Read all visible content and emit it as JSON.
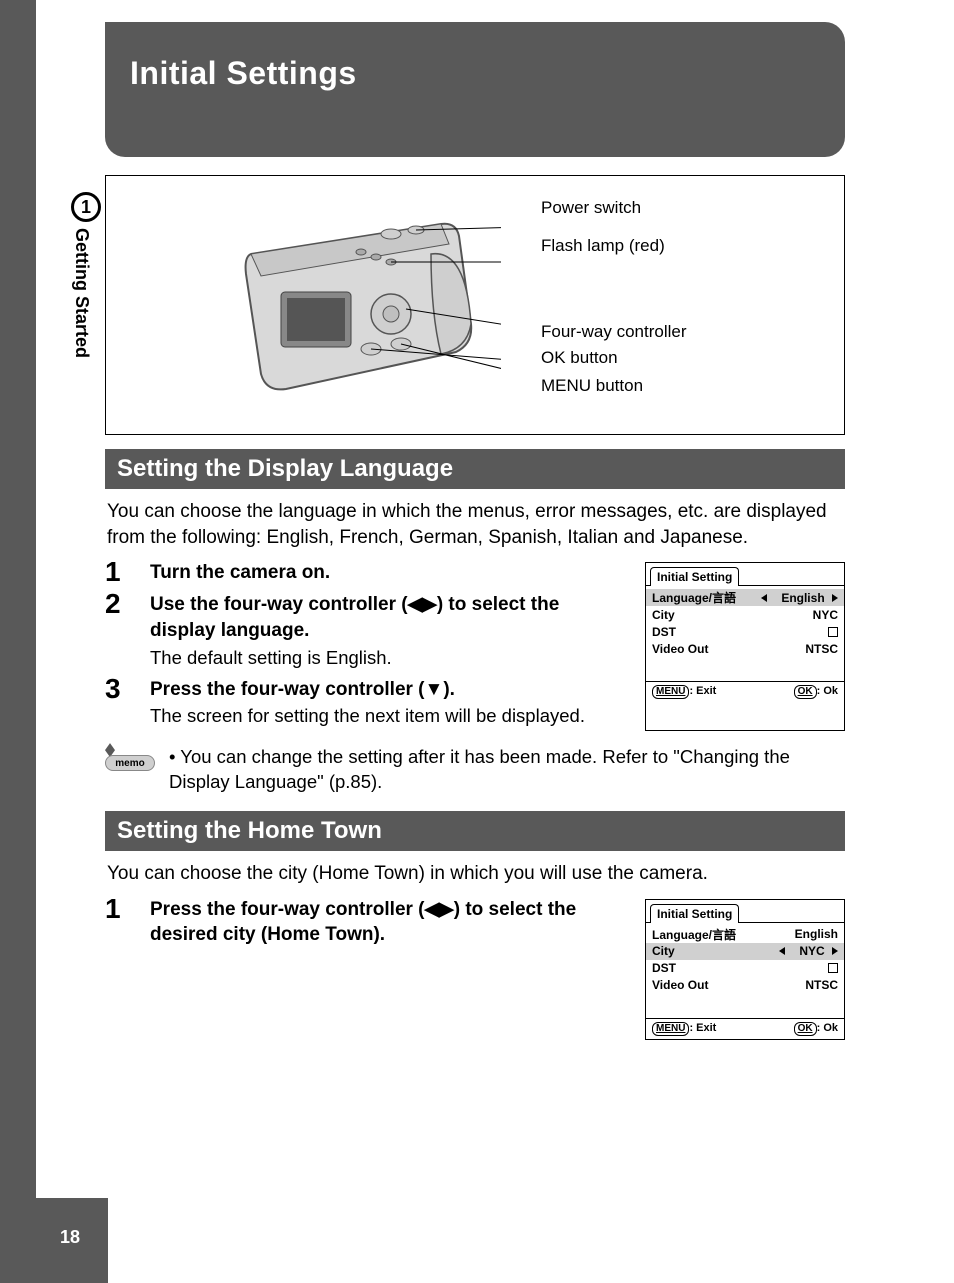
{
  "chapter": {
    "number": "1",
    "tab_label": "Getting Started"
  },
  "page_title": "Initial Settings",
  "page_number": "18",
  "diagram_callouts": {
    "c1": "Power switch",
    "c2": "Flash lamp (red)",
    "c3": "Four-way controller",
    "c4": "OK button",
    "c5": "MENU button"
  },
  "section1": {
    "heading": "Setting the Display Language",
    "intro": "You can choose the language in which the menus, error messages, etc. are displayed from the following: English, French, German, Spanish, Italian and Japanese.",
    "steps": [
      {
        "n": "1",
        "title": "Turn the camera on.",
        "sub": ""
      },
      {
        "n": "2",
        "title": "Use the four-way controller (◀▶) to select the display language.",
        "sub": "The default setting is English."
      },
      {
        "n": "3",
        "title": "Press the four-way controller (▼).",
        "sub": "The screen for setting the next item will be displayed."
      }
    ],
    "memo": "You can change the setting after it has been made. Refer to \"Changing the Display Language\" (p.85)."
  },
  "section2": {
    "heading": "Setting the Home Town",
    "intro": "You can choose the city (Home Town) in which you will use the camera.",
    "steps": [
      {
        "n": "1",
        "title": "Press the four-way controller (◀▶) to select the desired city (Home Town).",
        "sub": ""
      }
    ]
  },
  "lcd": {
    "tab": "Initial Setting",
    "rows": {
      "language_label": "Language/言語",
      "language_value": "English",
      "city_label": "City",
      "city_value": "NYC",
      "dst_label": "DST",
      "video_label": "Video Out",
      "video_value": "NTSC"
    },
    "footer": {
      "menu_key": "MENU",
      "menu_label": ": Exit",
      "ok_key": "OK",
      "ok_label": ": Ok"
    }
  },
  "memo_label": "memo"
}
